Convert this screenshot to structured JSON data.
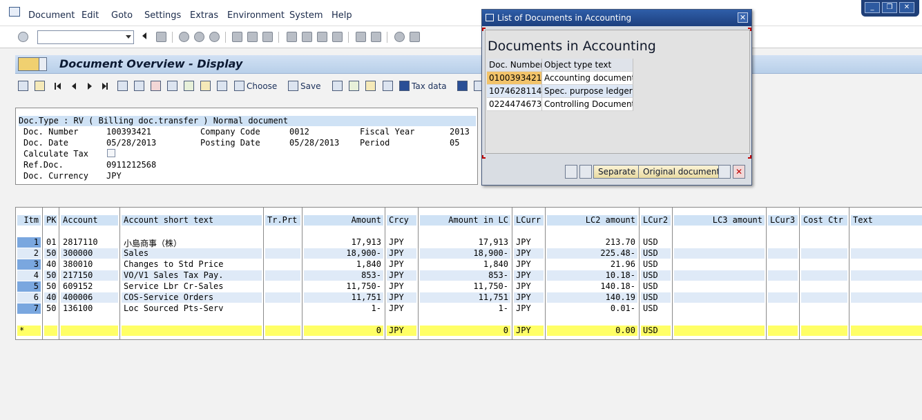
{
  "menu": [
    "Document",
    "Edit",
    "Goto",
    "Settings",
    "Extras",
    "Environment",
    "System",
    "Help"
  ],
  "window_controls": [
    "_",
    "❐",
    "✕"
  ],
  "title": "Document Overview - Display",
  "app_toolbar": {
    "choose_label": "Choose",
    "save_label": "Save",
    "taxdata_label": "Tax data"
  },
  "header": {
    "doctype_line": "Doc.Type : RV ( Billing doc.transfer ) Normal document",
    "doc_number_label": "Doc. Number",
    "doc_number": "100393421",
    "company_code_label": "Company Code",
    "company_code": "0012",
    "fiscal_year_label": "Fiscal Year",
    "fiscal_year": "2013",
    "doc_date_label": "Doc. Date",
    "doc_date": "05/28/2013",
    "posting_date_label": "Posting Date",
    "posting_date": "05/28/2013",
    "period_label": "Period",
    "period": "05",
    "calc_tax_label": "Calculate Tax",
    "ref_doc_label": "Ref.Doc.",
    "ref_doc": "0911212568",
    "doc_currency_label": "Doc. Currency",
    "doc_currency": "JPY"
  },
  "items": {
    "columns": [
      "Itm",
      "PK",
      "Account",
      "Account short text",
      "Tr.Prt",
      "Amount",
      "Crcy",
      "Amount in LC",
      "LCurr",
      "LC2 amount",
      "LCur2",
      "LC3 amount",
      "LCur3",
      "Cost Ctr",
      "Text"
    ],
    "rows": [
      {
        "itm": "1",
        "pk": "01",
        "account": "2817110",
        "text": "小島商事（株）",
        "amount": "17,913",
        "crcy": "JPY",
        "amount_lc": "17,913",
        "lcurr": "JPY",
        "lc2": "213.70",
        "lcur2": "USD"
      },
      {
        "itm": "2",
        "pk": "50",
        "account": "300000",
        "text": "Sales",
        "amount": "18,900-",
        "crcy": "JPY",
        "amount_lc": "18,900-",
        "lcurr": "JPY",
        "lc2": "225.48-",
        "lcur2": "USD"
      },
      {
        "itm": "3",
        "pk": "40",
        "account": "380010",
        "text": "Changes to Std Price",
        "amount": "1,840",
        "crcy": "JPY",
        "amount_lc": "1,840",
        "lcurr": "JPY",
        "lc2": "21.96",
        "lcur2": "USD"
      },
      {
        "itm": "4",
        "pk": "50",
        "account": "217150",
        "text": "VO/V1 Sales Tax Pay.",
        "amount": "853-",
        "crcy": "JPY",
        "amount_lc": "853-",
        "lcurr": "JPY",
        "lc2": "10.18-",
        "lcur2": "USD"
      },
      {
        "itm": "5",
        "pk": "50",
        "account": "609152",
        "text": "Service Lbr Cr-Sales",
        "amount": "11,750-",
        "crcy": "JPY",
        "amount_lc": "11,750-",
        "lcurr": "JPY",
        "lc2": "140.18-",
        "lcur2": "USD"
      },
      {
        "itm": "6",
        "pk": "40",
        "account": "400006",
        "text": "COS-Service Orders",
        "amount": "11,751",
        "crcy": "JPY",
        "amount_lc": "11,751",
        "lcurr": "JPY",
        "lc2": "140.19",
        "lcur2": "USD"
      },
      {
        "itm": "7",
        "pk": "50",
        "account": "136100",
        "text": "Loc Sourced Pts-Serv",
        "amount": "1-",
        "crcy": "JPY",
        "amount_lc": "1-",
        "lcurr": "JPY",
        "lc2": "0.01-",
        "lcur2": "USD"
      }
    ],
    "total": {
      "marker": "*",
      "amount": "0",
      "crcy": "JPY",
      "amount_lc": "0",
      "lcurr": "JPY",
      "lc2": "0.00",
      "lcur2": "USD"
    }
  },
  "popup": {
    "title": "List of Documents in Accounting",
    "close": "✕",
    "heading": "Documents in Accounting",
    "col_doc_number": "Doc. Number",
    "col_object_type": "Object type text",
    "rows": [
      {
        "doc": "0100393421",
        "type": "Accounting document"
      },
      {
        "doc": "1074628114",
        "type": "Spec. purpose ledger"
      },
      {
        "doc": "0224474673",
        "type": "Controlling Document"
      }
    ],
    "btn_separate": "Separate",
    "btn_original": "Original document"
  }
}
